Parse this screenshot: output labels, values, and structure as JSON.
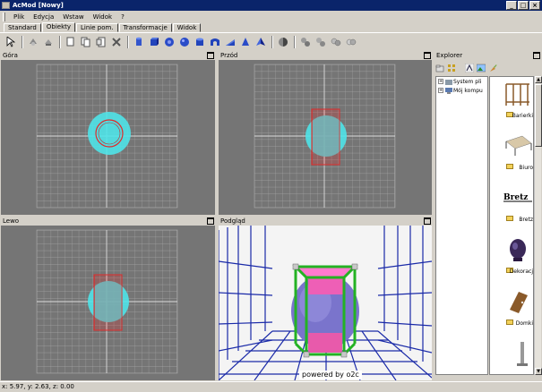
{
  "window": {
    "title": "AcMod [Nowy]"
  },
  "menu": [
    {
      "label": "Plik"
    },
    {
      "label": "Edycja"
    },
    {
      "label": "Wstaw"
    },
    {
      "label": "Widok"
    },
    {
      "label": "?"
    }
  ],
  "tabs": [
    {
      "label": "Standard",
      "active": false
    },
    {
      "label": "Obiekty",
      "active": true
    },
    {
      "label": "Linie pom.",
      "active": false
    },
    {
      "label": "Transformacje",
      "active": false
    },
    {
      "label": "Widok",
      "active": false
    }
  ],
  "toolbar_icons": [
    "pointer-icon",
    "rotate-icon",
    "move-icon",
    "copy-icon",
    "paste-icon",
    "page-icon",
    "delete-icon",
    "cylinder-icon",
    "box-icon",
    "disc-icon",
    "sphere-icon",
    "tube-icon",
    "arch-icon",
    "ramp-icon",
    "cone-icon",
    "pyramid-icon",
    "material-icon",
    "group-icon",
    "ungroup-icon",
    "lock-icon",
    "unlock-icon"
  ],
  "viewports": {
    "top": {
      "title": "Góra"
    },
    "front": {
      "title": "Przód"
    },
    "left": {
      "title": "Lewo"
    },
    "preview": {
      "title": "Podgląd",
      "watermark": "powered by o2c"
    }
  },
  "explorer": {
    "title": "Explorer",
    "tree": [
      {
        "label": "System pli"
      },
      {
        "label": "Mój kompu"
      }
    ],
    "library": [
      {
        "label": "Barierki"
      },
      {
        "label": "Biuro"
      },
      {
        "label": "Bretz"
      },
      {
        "label": "Dekoracj"
      },
      {
        "label": "Domki"
      }
    ]
  },
  "status": {
    "text": "x: 5.97, y: 2.63, z: 0.00"
  },
  "colors": {
    "title_bar": "#0a246a",
    "wireframe_cyan": "#4fe3e8",
    "selection_red": "#e02a2a",
    "viewport_bg": "#757575",
    "preview_floor": "#1a2aa8"
  }
}
